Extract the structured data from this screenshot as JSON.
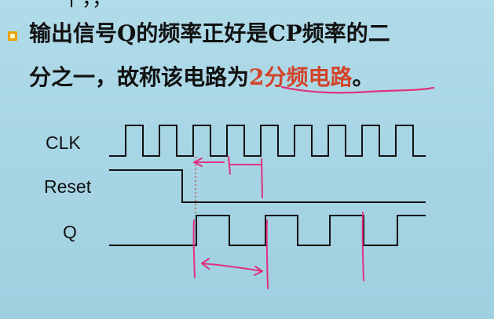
{
  "slide": {
    "top_partial_text": "一一一十，，一一一一一一一",
    "line1": "输出信号Q的频率正好是CP频率的二",
    "line2_prefix": "分之一，故称该电路为",
    "line2_highlight": "2分频电路",
    "line2_suffix": "。"
  },
  "timing_diagram": {
    "signals": [
      {
        "label": "CLK"
      },
      {
        "label": "Reset"
      },
      {
        "label": "Q"
      }
    ]
  },
  "colors": {
    "background": "#a9d4e3",
    "text": "#111111",
    "bullet": "#e9a400",
    "highlight": "#d2442a",
    "annotation": "#e0317d"
  }
}
